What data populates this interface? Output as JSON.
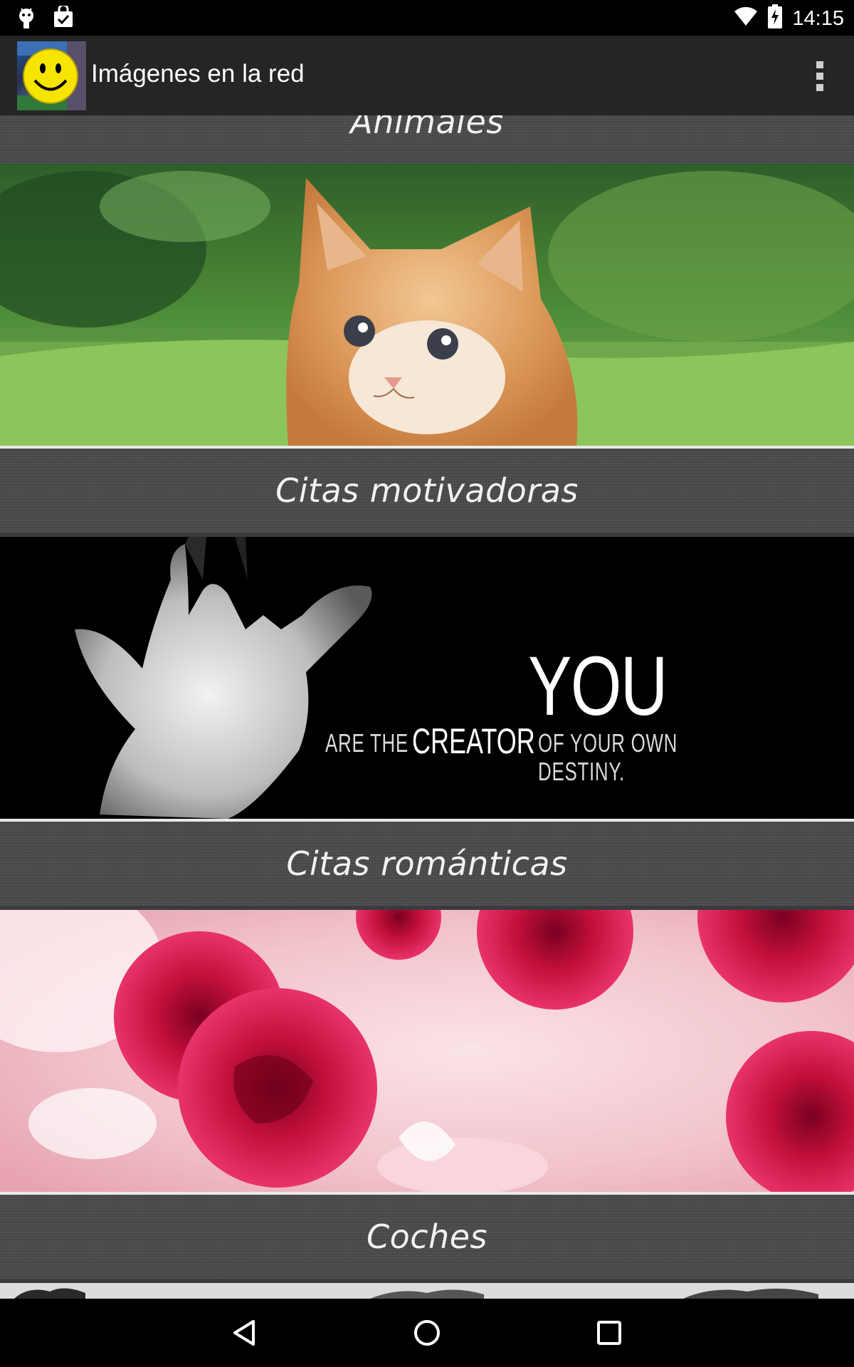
{
  "status_bar": {
    "time": "14:15",
    "icons": [
      "android-debug-icon",
      "play-store-bag-icon",
      "wifi-icon",
      "battery-charging-icon"
    ]
  },
  "action_bar": {
    "title": "Imágenes en la red",
    "logo_icon": "smiley-logo-icon",
    "menu_icon": "overflow-menu-icon"
  },
  "categories": [
    {
      "label": "Animales",
      "image": "kitten-in-grass-image"
    },
    {
      "label": "Citas motivadoras",
      "image": "hand-quote-image",
      "image_text": {
        "you": "YOU",
        "line_pre": "ARE THE",
        "line_bold": "CREATOR",
        "line_post": "OF YOUR OWN DESTINY."
      }
    },
    {
      "label": "Citas románticas",
      "image": "red-roses-image"
    },
    {
      "label": "Coches",
      "image": "cars-image"
    }
  ],
  "nav_bar": {
    "back_icon": "back-icon",
    "home_icon": "home-icon",
    "recents_icon": "recents-icon"
  },
  "colors": {
    "status_bar": "#000000",
    "action_bar": "#252525",
    "header_bg": "#48494b",
    "divider": "#e9e9e9"
  }
}
